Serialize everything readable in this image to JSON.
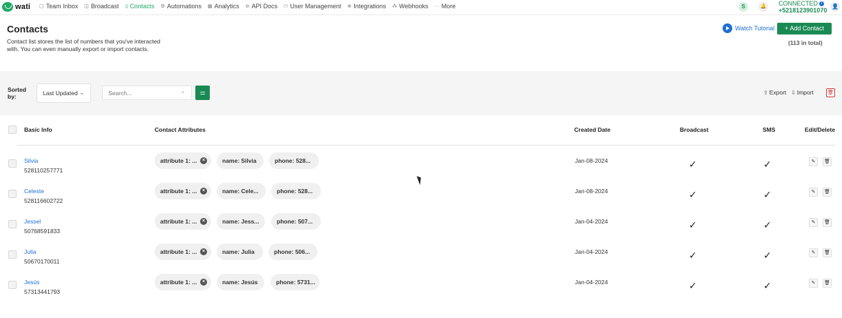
{
  "nav": {
    "logo": "wati",
    "items": [
      {
        "label": "Team Inbox",
        "icon": "inbox-icon",
        "active": false
      },
      {
        "label": "Broadcast",
        "icon": "broadcast-icon",
        "active": false
      },
      {
        "label": "Contacts",
        "icon": "contacts-icon",
        "active": true
      },
      {
        "label": "Automations",
        "icon": "automations-icon",
        "active": false
      },
      {
        "label": "Analytics",
        "icon": "analytics-icon",
        "active": false
      },
      {
        "label": "API Docs",
        "icon": "api-docs-icon",
        "active": false
      },
      {
        "label": "User Management",
        "icon": "user-management-icon",
        "active": false
      },
      {
        "label": "Integrations",
        "icon": "integrations-icon",
        "active": false
      },
      {
        "label": "Webhooks",
        "icon": "webhooks-icon",
        "active": false
      },
      {
        "label": "More",
        "icon": "more-icon",
        "active": false
      }
    ],
    "avatar_letter": "S",
    "status": "CONNECTED",
    "phone": "+5218123901070"
  },
  "header": {
    "title": "Contacts",
    "description": "Contact list stores the list of numbers that you've interacted with. You can even manually export or import contacts.",
    "watch_tutorial": "Watch Tutorial",
    "add_contact": "+ Add Contact",
    "total": "(113 in total)"
  },
  "toolbar": {
    "sorted_by": "Sorted by:",
    "sort_value": "Last Updated",
    "search_placeholder": "Search...",
    "export": "Export",
    "import": "Import"
  },
  "table": {
    "columns": {
      "basic_info": "Basic Info",
      "contact_attributes": "Contact Attributes",
      "created_date": "Created Date",
      "broadcast": "Broadcast",
      "sms": "SMS",
      "edit_delete": "Edit/Delete"
    },
    "rows": [
      {
        "name": "Silvia",
        "number": "528110257771",
        "attr1": "attribute 1: ...",
        "attr2": "name: Silvia",
        "attr3": "phone: 528...",
        "created": "Jan-08-2024",
        "broadcast": "✓",
        "sms": "✓"
      },
      {
        "name": "Celeste",
        "number": "528116602722",
        "attr1": "attribute 1: ...",
        "attr2": "name: Cele...",
        "attr3": "phone: 528...",
        "created": "Jan-08-2024",
        "broadcast": "✓",
        "sms": "✓"
      },
      {
        "name": "Jessel",
        "number": "50768591833",
        "attr1": "attribute 1: ...",
        "attr2": "name: Jess...",
        "attr3": "phone: 507...",
        "created": "Jan-04-2024",
        "broadcast": "✓",
        "sms": "✓"
      },
      {
        "name": "Julia",
        "number": "50670170011",
        "attr1": "attribute 1: ...",
        "attr2": "name: Julia",
        "attr3": "phone: 506...",
        "created": "Jan-04-2024",
        "broadcast": "✓",
        "sms": "✓"
      },
      {
        "name": "Jesús",
        "number": "57313441793",
        "attr1": "attribute 1: ...",
        "attr2": "name: Jesús",
        "attr3": "phone: 5731...",
        "created": "Jan-04-2024",
        "broadcast": "✓",
        "sms": "✓"
      }
    ]
  }
}
